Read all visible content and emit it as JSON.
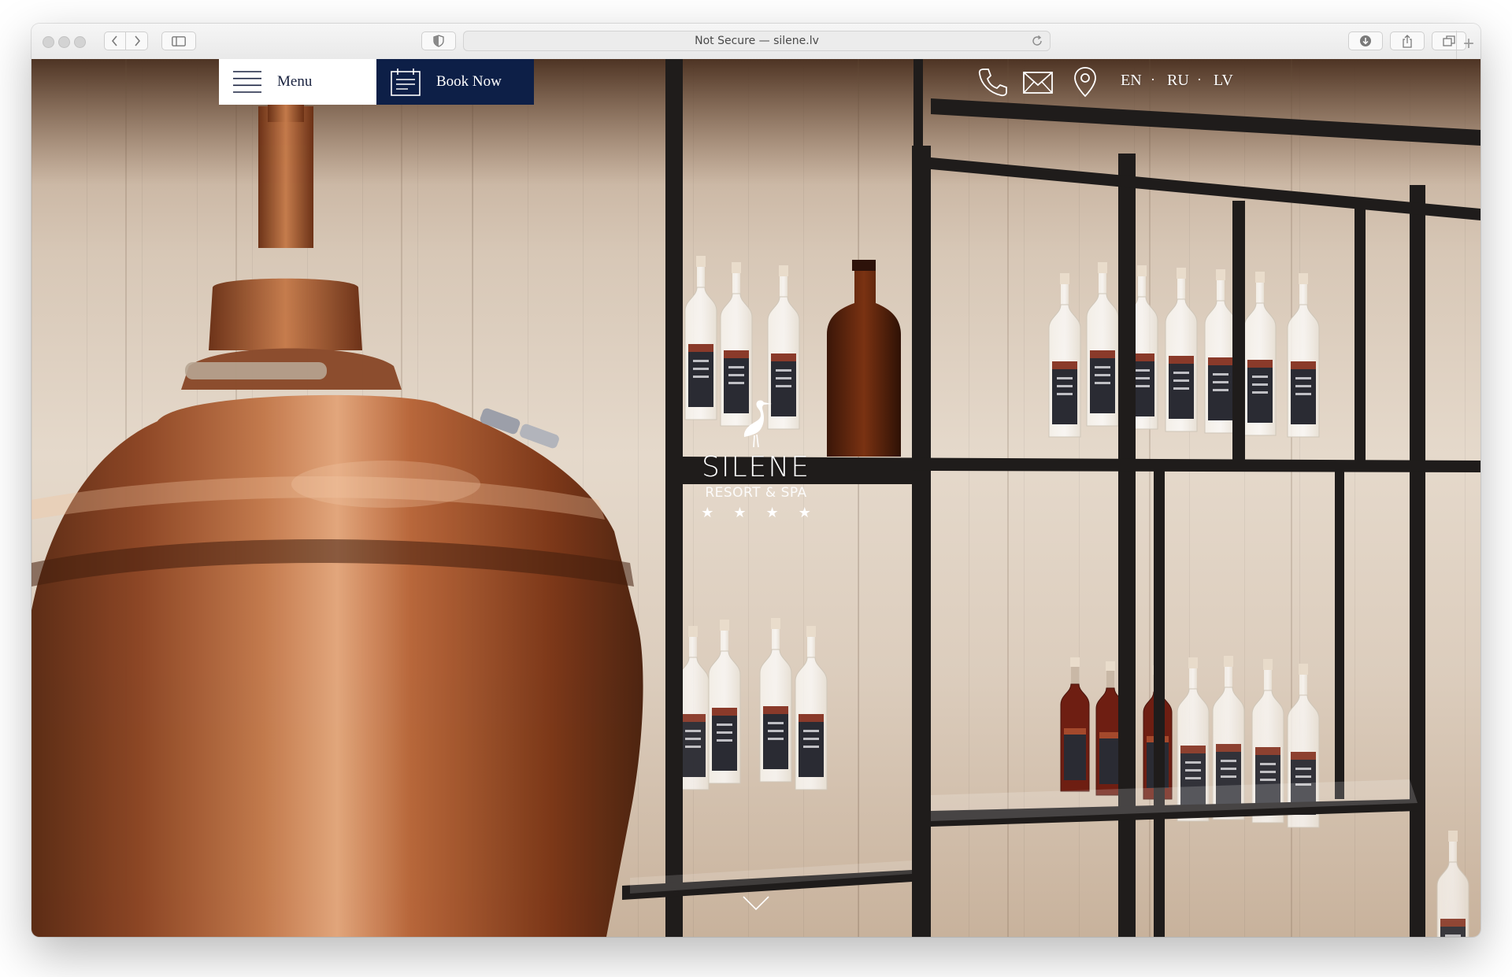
{
  "browser": {
    "address": "Not Secure — silene.lv"
  },
  "header": {
    "menu_label": "Menu",
    "book_label": "Book Now",
    "languages": [
      "EN",
      "RU",
      "LV"
    ]
  },
  "logo": {
    "name": "SILENE",
    "tagline": "RESORT & SPA",
    "stars": "★ ★ ★ ★"
  },
  "colors": {
    "brand_navy": "#0d1f47",
    "accent_white": "#ffffff"
  },
  "icons": {
    "menu": "hamburger-icon",
    "book": "calendar-icon",
    "phone": "phone-icon",
    "email": "envelope-icon",
    "location": "map-pin-icon",
    "scroll": "chevron-down-icon"
  }
}
